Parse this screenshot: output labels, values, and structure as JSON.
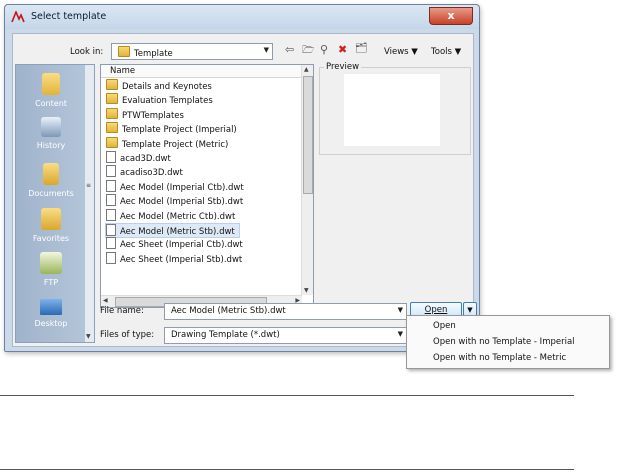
{
  "window": {
    "title": "Select template",
    "close_label": "x"
  },
  "lookin": {
    "label": "Look in:",
    "value": "Template"
  },
  "toolbar": {
    "views_label": "Views",
    "tools_label": "Tools"
  },
  "places": [
    {
      "label": "Content"
    },
    {
      "label": "History"
    },
    {
      "label": "Documents"
    },
    {
      "label": "Favorites"
    },
    {
      "label": "FTP"
    },
    {
      "label": "Desktop"
    }
  ],
  "filelist": {
    "column": "Name",
    "items": [
      {
        "name": "Details and Keynotes",
        "kind": "folder"
      },
      {
        "name": "Evaluation Templates",
        "kind": "folder"
      },
      {
        "name": "PTWTemplates",
        "kind": "folder"
      },
      {
        "name": "Template Project (Imperial)",
        "kind": "folder"
      },
      {
        "name": "Template Project (Metric)",
        "kind": "folder"
      },
      {
        "name": "acad3D.dwt",
        "kind": "dwt"
      },
      {
        "name": "acadiso3D.dwt",
        "kind": "dwt"
      },
      {
        "name": "Aec Model (Imperial Ctb).dwt",
        "kind": "dwt"
      },
      {
        "name": "Aec Model (Imperial Stb).dwt",
        "kind": "dwt"
      },
      {
        "name": "Aec Model (Metric Ctb).dwt",
        "kind": "dwt"
      },
      {
        "name": "Aec Model (Metric Stb).dwt",
        "kind": "dwt",
        "selected": true
      },
      {
        "name": "Aec Sheet (Imperial Ctb).dwt",
        "kind": "dwt"
      },
      {
        "name": "Aec Sheet (Imperial Stb).dwt",
        "kind": "dwt"
      }
    ]
  },
  "preview": {
    "label": "Preview"
  },
  "filename": {
    "label": "File name:",
    "value": "Aec Model (Metric Stb).dwt"
  },
  "filetype": {
    "label": "Files of type:",
    "value": "Drawing Template (*.dwt)"
  },
  "open_button": {
    "label": "Open"
  },
  "open_menu": {
    "items": [
      "Open",
      "Open with no Template - Imperial",
      "Open with no Template - Metric"
    ]
  },
  "colors": {
    "title_bar": "#c6d6ea",
    "places_bar": "#9fb3cb",
    "selection": "#dde9f7",
    "close": "#c8402a"
  },
  "icons": [
    "autocad-logo-icon",
    "folder-icon",
    "back-icon",
    "up-folder-icon",
    "search-web-icon",
    "delete-icon",
    "new-folder-icon",
    "dropdown-arrow-icon"
  ]
}
